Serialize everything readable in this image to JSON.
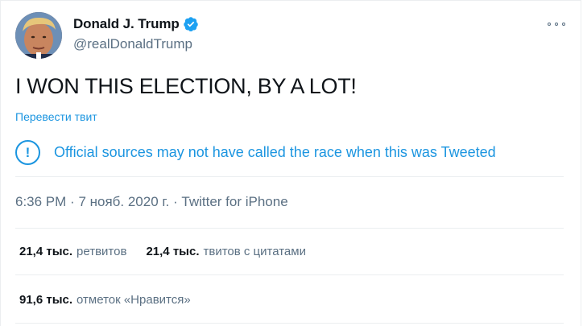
{
  "user": {
    "display_name": "Donald J. Trump",
    "handle": "@realDonaldTrump"
  },
  "tweet": {
    "text": "I WON THIS ELECTION, BY A LOT!",
    "translate_label": "Перевести твит",
    "notice": "Official sources may not have called the race when this was Tweeted",
    "notice_icon_glyph": "!",
    "time": "6:36 PM",
    "date": "7 нояб. 2020 г.",
    "source": "Twitter for iPhone",
    "separator": "·"
  },
  "stats": {
    "retweets_count": "21,4 тыс.",
    "retweets_label": "ретвитов",
    "quotes_count": "21,4 тыс.",
    "quotes_label": "твитов с цитатами",
    "likes_count": "91,6 тыс.",
    "likes_label": "отметок «Нравится»"
  },
  "colors": {
    "link_blue": "#1b95e0",
    "muted_text": "#5b7083",
    "primary_text": "#0f1419",
    "verified_badge": "#1da1f2"
  },
  "icons": {
    "verified": "verified-badge-icon",
    "more": "more-options-icon",
    "notice": "exclamation-circle-icon"
  }
}
